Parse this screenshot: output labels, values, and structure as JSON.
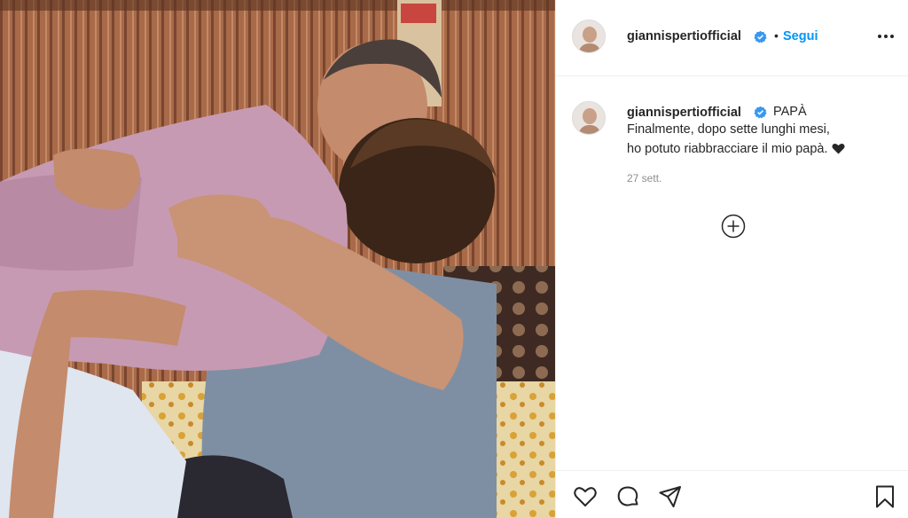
{
  "post": {
    "username": "giannispertiofficial",
    "verified": true,
    "follow_label": "Segui",
    "separator": "•",
    "more_icon": "more-options-icon"
  },
  "caption": {
    "username": "giannispertiofficial",
    "title": "PAPÀ",
    "line1": "Finalmente, dopo sette lunghi mesi,",
    "line2": "ho potuto riabbracciare il mio papà.",
    "emoji": "black-heart-icon",
    "time": "27 sett."
  },
  "load_more_icon": "plus-circle-icon",
  "actions": {
    "like_icon": "heart-icon",
    "comment_icon": "comment-icon",
    "share_icon": "share-icon",
    "save_icon": "bookmark-icon"
  },
  "colors": {
    "accent": "#0095f6",
    "text": "#262626",
    "muted": "#8e8e8e",
    "verified": "#3897f0"
  }
}
